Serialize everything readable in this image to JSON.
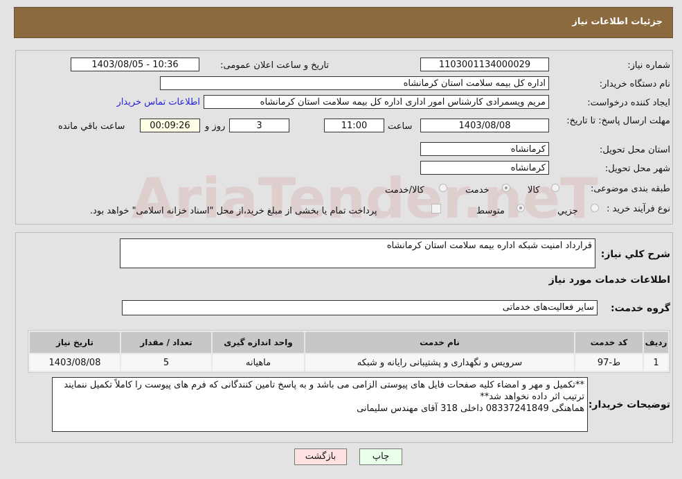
{
  "header": {
    "title": "جزئیات اطلاعات نیاز"
  },
  "form": {
    "need_number_label": "شماره نیاز:",
    "need_number": "1103001134000029",
    "announce_label": "تاریخ و ساعت اعلان عمومی:",
    "announce_value": "1403/08/05 - 10:36",
    "buyer_label": "نام دستگاه خریدار:",
    "buyer": "اداره کل بیمه سلامت استان کرمانشاه",
    "creator_label": "ایجاد کننده درخواست:",
    "creator": "مریم ویسمرادی کارشناس امور اداری اداره کل بیمه سلامت استان کرمانشاه",
    "contact_link": "اطلاعات تماس خریدار",
    "deadline_label": "مهلت ارسال پاسخ: تا تاریخ:",
    "deadline_date": "1403/08/08",
    "time_label": "ساعت",
    "deadline_time": "11:00",
    "days": "3",
    "days_label": "روز و",
    "remaining": "00:09:26",
    "remaining_label": "ساعت باقي مانده",
    "province_label": "استان محل تحویل:",
    "province": "کرمانشاه",
    "city_label": "شهر محل تحویل:",
    "city": "کرمانشاه",
    "category_label": "طبقه بندی موضوعی:",
    "category_options": [
      "کالا",
      "خدمت",
      "کالا/خدمت"
    ],
    "category_selected": "خدمت",
    "process_label": "نوع فرآیند خرید :",
    "process_options": [
      "جزیي",
      "متوسط"
    ],
    "process_selected": "متوسط",
    "process_note": "پرداخت تمام یا بخشی از مبلغ خرید،از محل \"اسناد خزانه اسلامی\" خواهد بود."
  },
  "desc": {
    "label": "شرح کلي نیاز:",
    "value": "قرارداد امنیت شبکه اداره بیمه سلامت استان کرمانشاه"
  },
  "services": {
    "title": "اطلاعات خدمات مورد نیاز",
    "group_label": "گروه خدمت:",
    "group": "سایر فعالیت‌های خدماتی",
    "columns": [
      "ردیف",
      "کد خدمت",
      "نام خدمت",
      "واحد اندازه گیری",
      "تعداد / مقدار",
      "تاریخ نیاز"
    ],
    "rows": [
      [
        "1",
        "ط-97",
        "سرویس و نگهداری و پشتیبانی رایانه و شبکه",
        "ماهیانه",
        "5",
        "1403/08/08"
      ]
    ]
  },
  "notes": {
    "label": "توضیحات خریدار:",
    "lines": [
      "**تکمیل و مهر و امضاء کلیه صفحات فایل های پیوستی الزامی می باشد و به پاسخ تامین کنندگانی که فرم های پیوست را کاملاً تکمیل ننمایند ترتیب اثر داده نخواهد شد**",
      "هماهنگی 08337241849 داخلی 318 آقای مهندس سلیمانی"
    ]
  },
  "buttons": {
    "print": "چاپ",
    "back": "بازگشت"
  },
  "watermark": "AriaTender.neT"
}
